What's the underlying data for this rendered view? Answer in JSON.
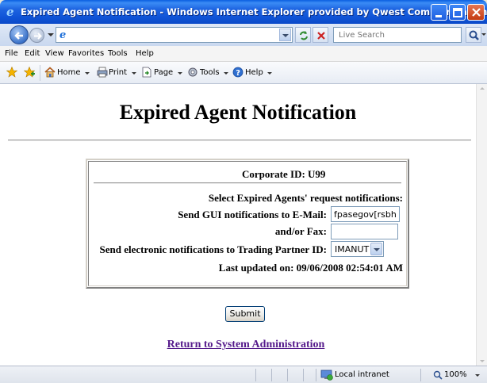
{
  "window": {
    "title": "Expired Agent Notification - Windows Internet Explorer provided by Qwest Communications"
  },
  "address_bar": {
    "url": "",
    "search_placeholder": "Live Search"
  },
  "menu": {
    "items": [
      "File",
      "Edit",
      "View",
      "Favorites",
      "Tools",
      "Help"
    ]
  },
  "command_bar": {
    "home": "Home",
    "print": "Print",
    "page": "Page",
    "tools": "Tools",
    "help": "Help"
  },
  "page": {
    "title": "Expired Agent Notification",
    "corporate_id": "Corporate ID: U99",
    "section_heading": "Select Expired Agents' request notifications:",
    "email_label": "Send GUI notifications to E-Mail:",
    "email_value": "fpasegov[rsbhr",
    "fax_label": "and/or Fax:",
    "fax_value": "",
    "partner_label": "Send electronic notifications to Trading Partner ID:",
    "partner_value": "IMANUT",
    "last_updated": "Last updated on: 09/06/2008 02:54:01 AM",
    "submit_label": "Submit",
    "return_link": "Return to System Administration"
  },
  "status_bar": {
    "zone": "Local intranet",
    "zoom": "100%"
  },
  "colors": {
    "titlebar": "#0f53d6",
    "link_visited": "#551a8b",
    "content_bg": "#ffffff"
  }
}
